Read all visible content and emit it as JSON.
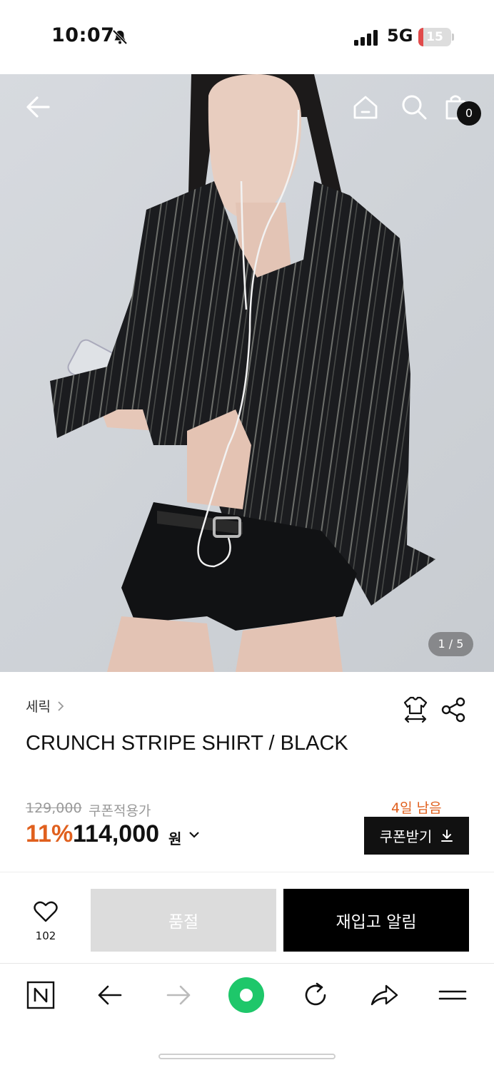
{
  "status_bar": {
    "time": "10:07",
    "network": "5G",
    "battery_level": "15",
    "battery_fraction": 0.15,
    "battery_color": "#e14b4b"
  },
  "hero": {
    "page_indicator": "1 / 5",
    "cart_count": "0"
  },
  "product": {
    "brand": "세릭",
    "title": "CRUNCH STRIPE SHIRT / BLACK",
    "original_price": "129,000",
    "coupon_note": "쿠폰적용가",
    "discount": "11%",
    "price": "114,000",
    "currency": "원",
    "days_left": "4일 남음",
    "coupon_button": "쿠폰받기"
  },
  "actions": {
    "like_count": "102",
    "soldout_label": "품절",
    "restock_label": "재입고 알림"
  },
  "colors": {
    "accent": "#e0601e",
    "primary": "#111111",
    "browser_green": "#1ec76a"
  }
}
